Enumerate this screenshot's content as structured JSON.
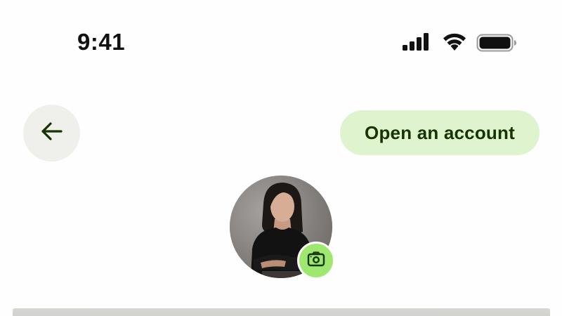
{
  "status_bar": {
    "time": "9:41",
    "icons": [
      "signal-icon",
      "wifi-icon",
      "battery-icon"
    ]
  },
  "header": {
    "back_icon": "arrow-left-icon",
    "open_account_label": "Open an account"
  },
  "profile": {
    "avatar": "profile-photo",
    "camera_icon": "camera-icon"
  },
  "colors": {
    "pill_background": "#dff3cf",
    "pill_text": "#163300",
    "back_button_background": "#efefec",
    "camera_badge": "#9fe870"
  }
}
